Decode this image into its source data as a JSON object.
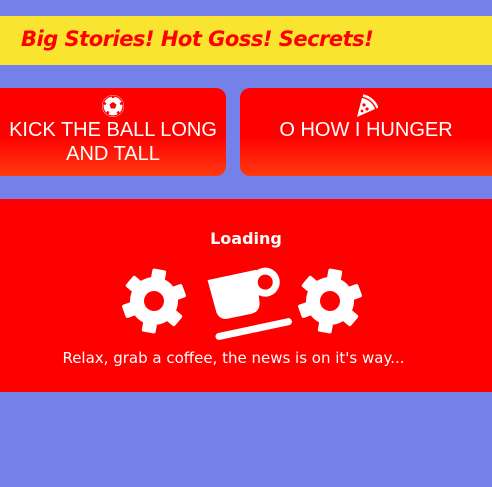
{
  "banner": {
    "title": "Big Stories! Hot Goss! Secrets!"
  },
  "categories": [
    {
      "label": "KICK THE BALL LONG AND TALL",
      "visible_label": "ICK THE BALL LONG AND TALL",
      "icon": "soccer-ball-icon"
    },
    {
      "label": "O HOW I HUNGER",
      "icon": "pizza-slice-icon"
    }
  ],
  "loading": {
    "title": "Loading",
    "message": "Relax, grab a coffee, the news is on it's way...",
    "icons": [
      "gear-icon",
      "coffee-cup-icon",
      "gear-icon"
    ]
  },
  "colors": {
    "background": "#7581e8",
    "banner": "#f9e42f",
    "accent": "#ff0000",
    "text": "#ffffff"
  }
}
